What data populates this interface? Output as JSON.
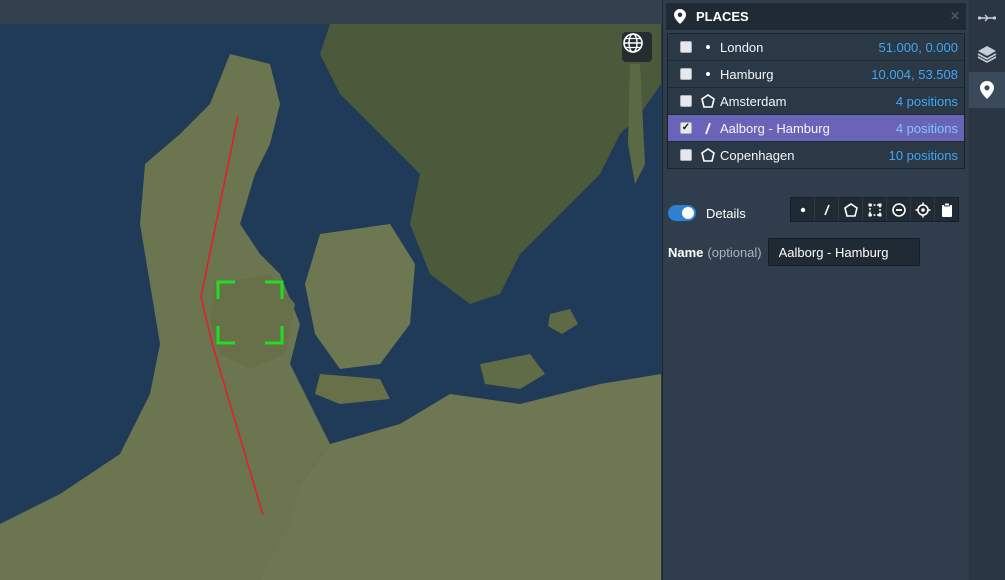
{
  "panel": {
    "title": "PLACES",
    "places": [
      {
        "checked": false,
        "icon": "point-icon",
        "name": "London",
        "value": "51.000, 0.000",
        "selected": false
      },
      {
        "checked": false,
        "icon": "point-icon",
        "name": "Hamburg",
        "value": "10.004, 53.508",
        "selected": false
      },
      {
        "checked": false,
        "icon": "polygon-icon",
        "name": "Amsterdam",
        "value": "4 positions",
        "selected": false
      },
      {
        "checked": true,
        "icon": "line-icon",
        "name": "Aalborg - Hamburg",
        "value": "4 positions",
        "selected": true
      },
      {
        "checked": false,
        "icon": "polygon-icon",
        "name": "Copenhagen",
        "value": "10 positions",
        "selected": false
      }
    ],
    "details_label": "Details",
    "name_label": "Name",
    "name_optional": "(optional)",
    "name_value": "Aalborg - Hamburg",
    "tools": [
      "point-icon",
      "line-icon",
      "polygon-icon",
      "rectangle-icon",
      "circle-minus-icon",
      "crosshair-icon",
      "clipboard-icon"
    ]
  },
  "map": {
    "line_color": "#e0202a",
    "target_color": "#22dd22"
  },
  "tabs": [
    "route-icon",
    "layers-icon",
    "map-pin-icon"
  ]
}
